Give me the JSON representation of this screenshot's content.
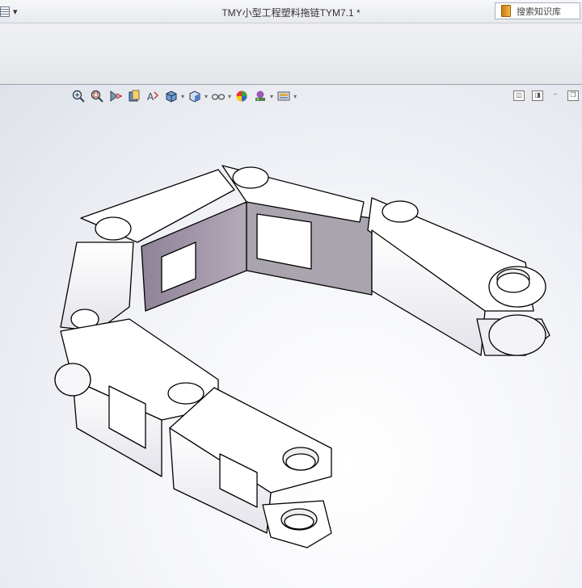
{
  "window": {
    "title": "TMY小型工程塑料拖链TYM7.1 *",
    "menu_arrow": "▾"
  },
  "search": {
    "placeholder": "搜索知识库"
  },
  "heads_up_toolbar": {
    "icons": [
      "zoom-to-fit-icon",
      "zoom-to-area-icon",
      "previous-view-icon",
      "section-view-icon",
      "dynamic-annotation-icon",
      "view-orientation-icon",
      "display-style-icon",
      "hide-show-items-icon",
      "edit-appearance-icon",
      "apply-scene-icon",
      "view-settings-icon"
    ]
  },
  "viewport_controls": {
    "restore": "◫",
    "minimize": "–",
    "maximize": "❐"
  },
  "colors": {
    "part_face": "#ffffff",
    "part_shade": "#e4e1ea",
    "part_dark": "#9d90a0",
    "edge": "#000000"
  }
}
